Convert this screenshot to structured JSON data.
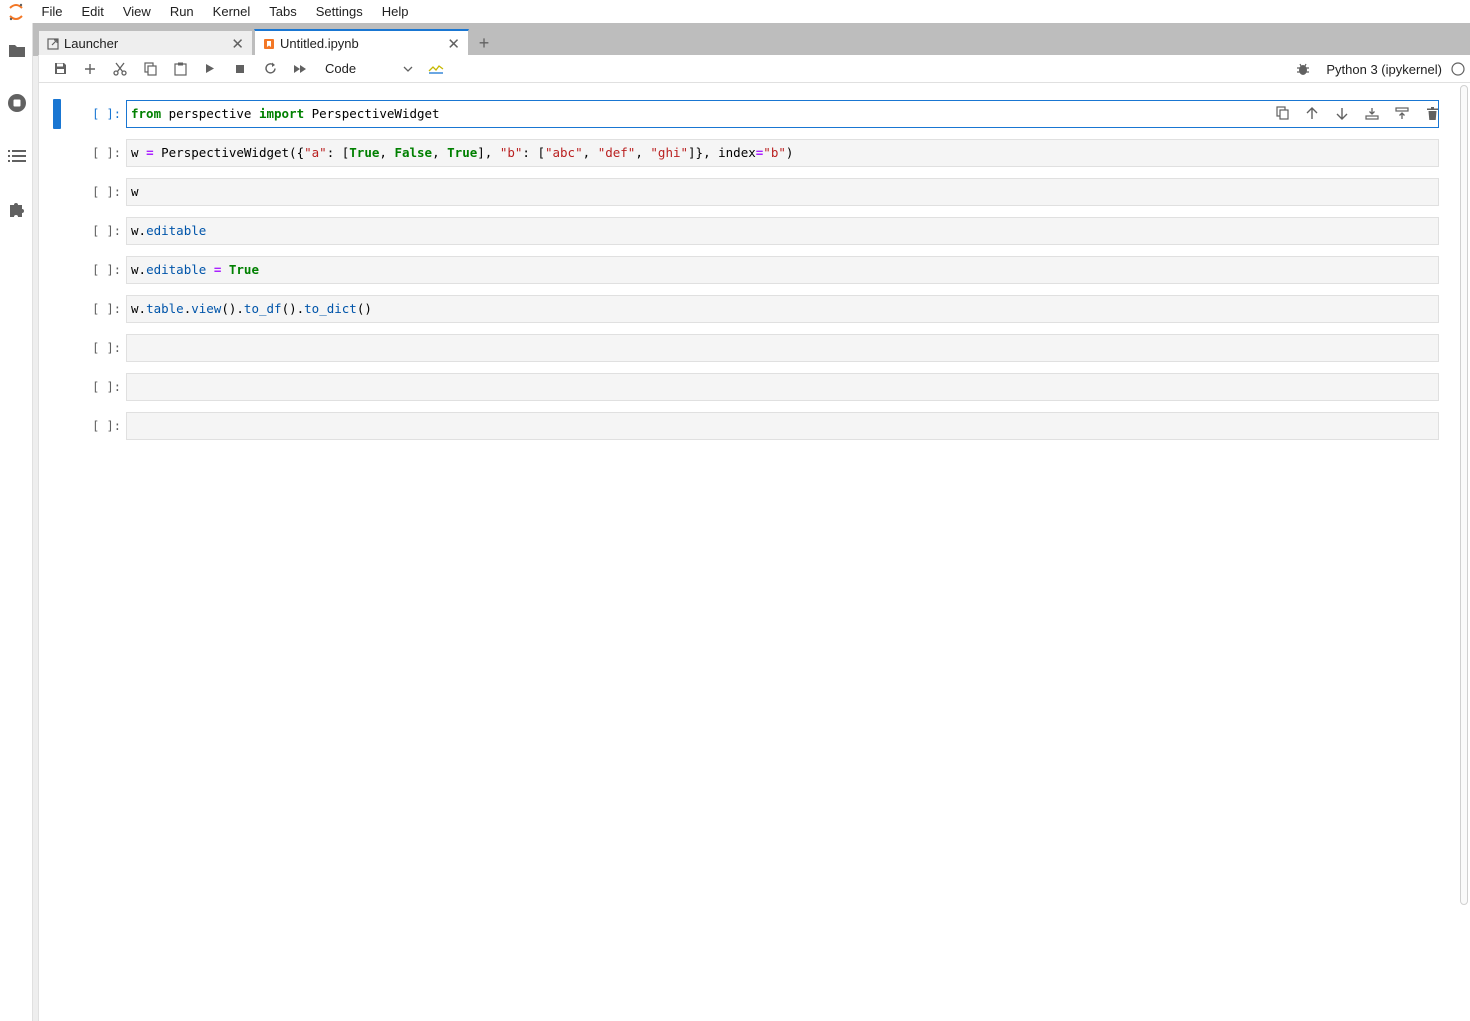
{
  "menubar": {
    "items": [
      "File",
      "Edit",
      "View",
      "Run",
      "Kernel",
      "Tabs",
      "Settings",
      "Help"
    ]
  },
  "tabs": [
    {
      "label": "Launcher",
      "icon": "launcher-icon",
      "active": false
    },
    {
      "label": "Untitled.ipynb",
      "icon": "notebook-icon",
      "active": true
    }
  ],
  "toolbar": {
    "cell_type": "Code",
    "kernel_name": "Python 3 (ipykernel)"
  },
  "cells": [
    {
      "prompt": "[ ]:",
      "code": "from perspective import PerspectiveWidget"
    },
    {
      "prompt": "[ ]:",
      "code": "w = PerspectiveWidget({\"a\": [True, False, True], \"b\": [\"abc\", \"def\", \"ghi\"]}, index=\"b\")"
    },
    {
      "prompt": "[ ]:",
      "code": "w"
    },
    {
      "prompt": "[ ]:",
      "code": "w.editable"
    },
    {
      "prompt": "[ ]:",
      "code": "w.editable = True"
    },
    {
      "prompt": "[ ]:",
      "code": "w.table.view().to_df().to_dict()"
    },
    {
      "prompt": "[ ]:",
      "code": ""
    },
    {
      "prompt": "[ ]:",
      "code": ""
    },
    {
      "prompt": "[ ]:",
      "code": ""
    }
  ],
  "colors": {
    "accent": "#1976d2",
    "jupyter_orange": "#f37726"
  }
}
